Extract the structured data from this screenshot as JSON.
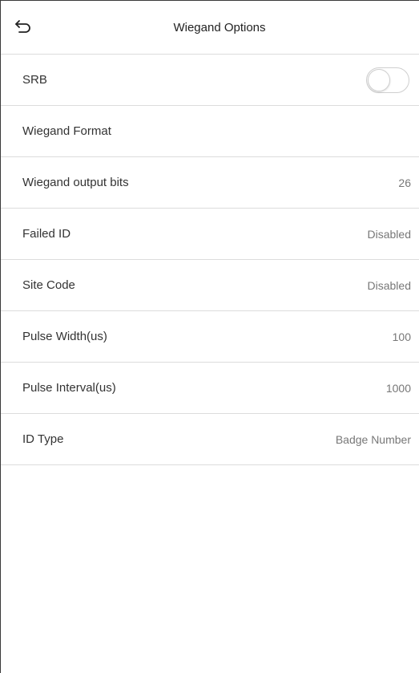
{
  "header": {
    "title": "Wiegand Options",
    "back_icon": "back-arrow-icon"
  },
  "settings": [
    {
      "label": "SRB",
      "type": "toggle",
      "on": false
    },
    {
      "label": "Wiegand Format",
      "value": ""
    },
    {
      "label": "Wiegand output bits",
      "value": "26"
    },
    {
      "label": "Failed ID",
      "value": "Disabled"
    },
    {
      "label": "Site Code",
      "value": "Disabled"
    },
    {
      "label": "Pulse Width(us)",
      "value": "100"
    },
    {
      "label": "Pulse Interval(us)",
      "value": "1000"
    },
    {
      "label": "ID Type",
      "value": "Badge Number"
    }
  ],
  "colors": {
    "divider": "#dcdcdc",
    "label": "#333333",
    "value": "#777777"
  }
}
